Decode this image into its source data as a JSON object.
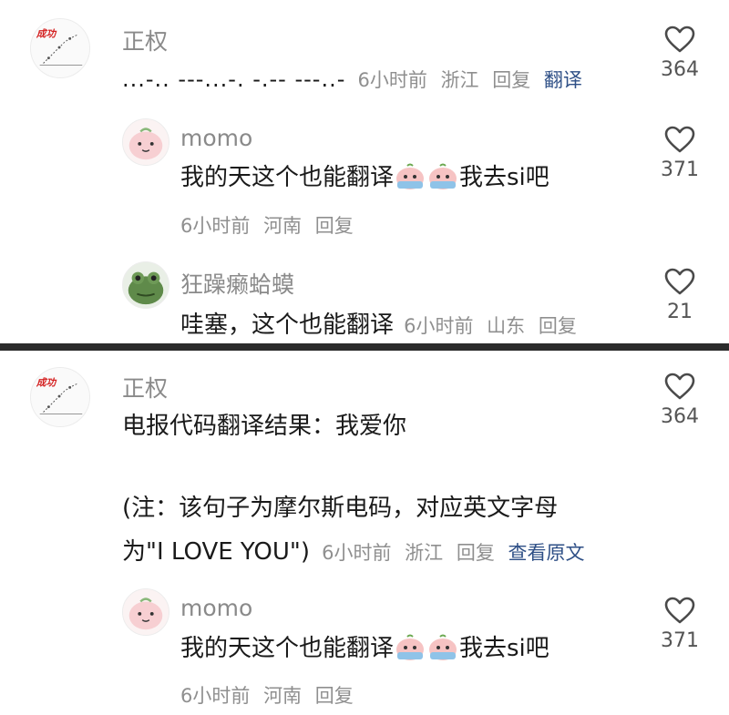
{
  "top_panel": {
    "comment": {
      "username": "正权",
      "text": "...-.. ---...-. -.-- ---..-",
      "time": "6小时前",
      "location": "浙江",
      "reply_label": "回复",
      "action_label": "翻译",
      "likes": "364"
    },
    "replies": [
      {
        "username": "momo",
        "text_before": "我的天这个也能翻译",
        "text_after": "我去si吧",
        "time": "6小时前",
        "location": "河南",
        "reply_label": "回复",
        "likes": "371"
      },
      {
        "username": "狂躁癞蛤蟆",
        "text": "哇塞，这个也能翻译",
        "time": "6小时前",
        "location": "山东",
        "reply_label": "回复",
        "likes": "21"
      }
    ]
  },
  "bottom_panel": {
    "comment": {
      "username": "正权",
      "line1": "电报代码翻译结果：我爱你",
      "line2": "(注：该句子为摩尔斯电码，对应英文字母",
      "line3": "为\"I LOVE YOU\")",
      "time": "6小时前",
      "location": "浙江",
      "reply_label": "回复",
      "action_label": "查看原文",
      "likes": "364"
    },
    "reply": {
      "username": "momo",
      "text_before": "我的天这个也能翻译",
      "text_after": "我去si吧",
      "time": "6小时前",
      "location": "河南",
      "reply_label": "回复",
      "likes": "371"
    }
  },
  "avatar_logo_text": "成功",
  "colors": {
    "link": "#2e4f86",
    "meta": "#8f8f8f",
    "username": "#8a8a8a",
    "divider": "#2b2b2b"
  },
  "icons": [
    "heart-outline-icon",
    "crying-emoji-icon"
  ]
}
